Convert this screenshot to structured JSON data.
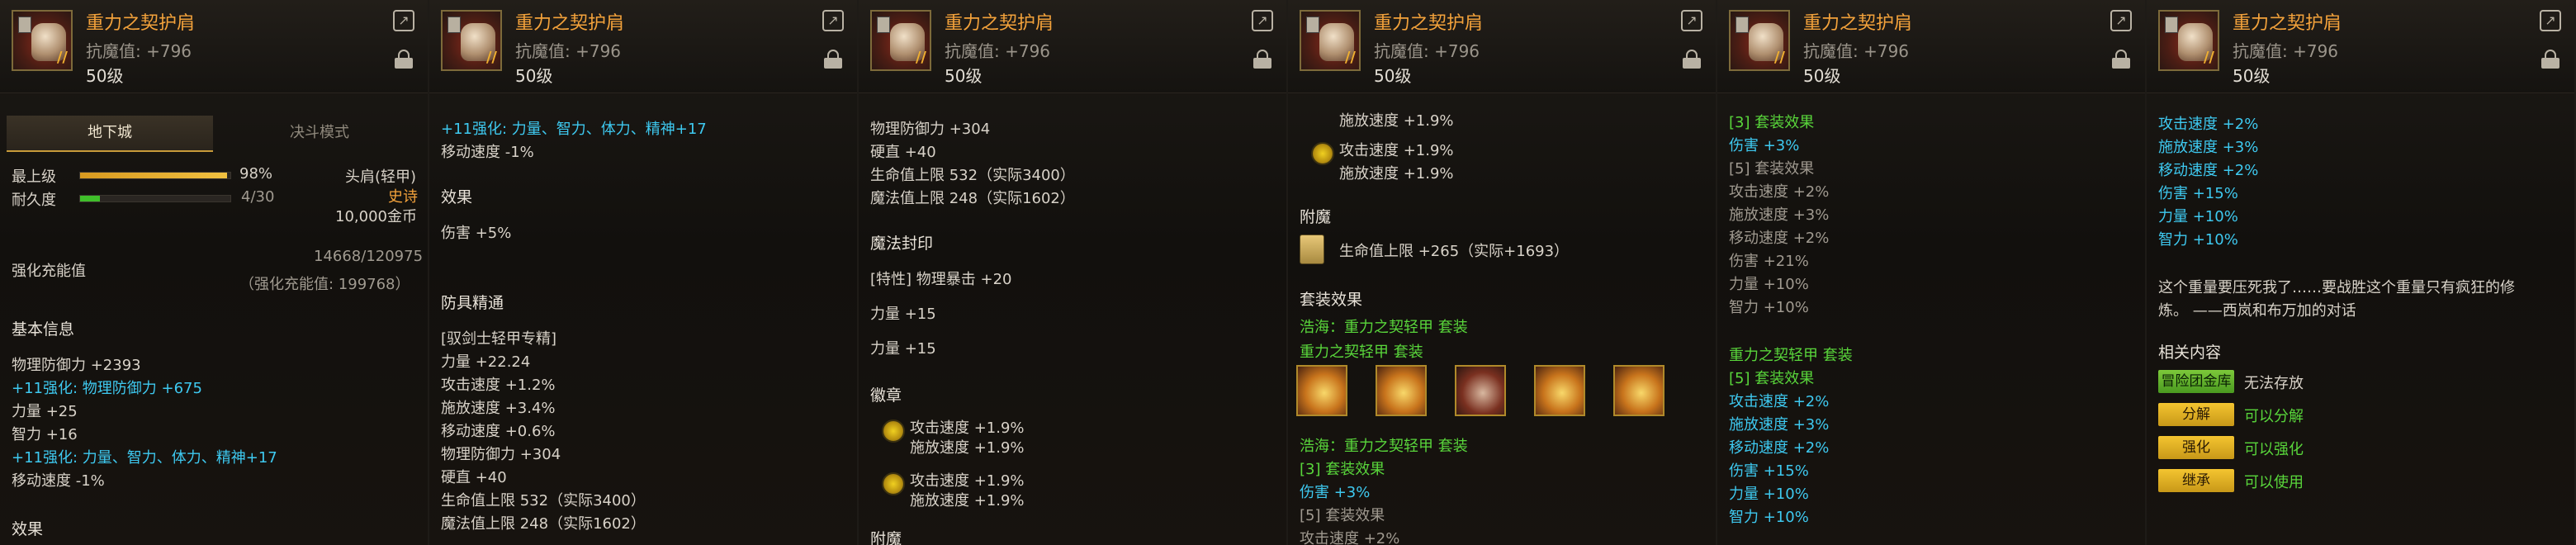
{
  "item": {
    "name": "重力之契护肩",
    "magic_resist": "抗魔值: +796",
    "level": "50级",
    "icon_mark": "//"
  },
  "p1": {
    "tab_dungeon": "地下城",
    "tab_duel": "决斗模式",
    "level_label": "最上级",
    "level_value": "98%",
    "level_fill": 0.98,
    "dur_label": "耐久度",
    "dur_value": "4/30",
    "dur_fill": 0.13,
    "slot": "头肩(轻甲)",
    "rarity": "史诗",
    "price": "10,000金币",
    "amp_label": "强化充能值",
    "amp_value": "14668/120975",
    "amp_note": "（强化充能值: 199768）",
    "basic_title": "基本信息",
    "l1": "物理防御力 +2393",
    "l2": "+11强化: 物理防御力 +675",
    "l3": "力量 +25",
    "l4": "智力 +16",
    "l5": "+11强化: 力量、智力、体力、精神+17",
    "l6": "移动速度 -1%",
    "effect_title": "效果"
  },
  "p2": {
    "top_cut": "智力 +16",
    "l1": "+11强化: 力量、智力、体力、精神+17",
    "l2": "移动速度 -1%",
    "eff_title": "效果",
    "eff1": "伤害 +5%",
    "ar_title": "防具精通",
    "ar_sub": "[驭剑士轻甲专精]",
    "a1": "力量 +22.24",
    "a2": "攻击速度 +1.2%",
    "a3": "施放速度 +3.4%",
    "a4": "移动速度 +0.6%",
    "a5": "物理防御力 +304",
    "a6": "硬直 +40",
    "a7": "生命值上限 532（实际3400）",
    "a8": "魔法值上限 248（实际1602）"
  },
  "p3": {
    "top_cut": "移动速度 +0.6%",
    "l1": "物理防御力 +304",
    "l2": "硬直 +40",
    "l3": "生命值上限 532（实际3400）",
    "l4": "魔法值上限 248（实际1602）",
    "seal_title": "魔法封印",
    "seal1": "[特性] 物理暴击 +20",
    "seal2": "力量 +15",
    "seal3": "力量 +15",
    "emb_title": "徽章",
    "e1a": "攻击速度 +1.9%",
    "e1b": "施放速度 +1.9%",
    "e2a": "攻击速度 +1.9%",
    "e2b": "施放速度 +1.9%",
    "ench_title": "附魔"
  },
  "p4": {
    "top_a": "施放速度 +1.9%",
    "e2a": "攻击速度 +1.9%",
    "e2b": "施放速度 +1.9%",
    "ench_title": "附魔",
    "ench1": "生命值上限 +265（实际+1693）",
    "set_title": "套装效果",
    "set1": "浩海：重力之契轻甲 套装",
    "set2": "重力之契轻甲 套装",
    "set3": "浩海：重力之契轻甲 套装",
    "set4": "[3] 套装效果",
    "set5": "伤害 +3%",
    "set6": "[5] 套装效果",
    "set7": "攻击速度 +2%"
  },
  "p5": {
    "s1": "[3] 套装效果",
    "s2": "伤害 +3%",
    "s3": "[5] 套装效果",
    "s4": "攻击速度 +2%",
    "s5": "施放速度 +3%",
    "s6": "移动速度 +2%",
    "s7": "伤害 +21%",
    "s8": "力量 +10%",
    "s9": "智力 +10%",
    "t1": "重力之契轻甲 套装",
    "t2": "[5] 套装效果",
    "t3": "攻击速度 +2%",
    "t4": "施放速度 +3%",
    "t5": "移动速度 +2%",
    "t6": "伤害 +15%",
    "t7": "力量 +10%",
    "t8": "智力 +10%"
  },
  "p6": {
    "top_cut": "[5] 套装效果",
    "r1": "攻击速度 +2%",
    "r2": "施放速度 +3%",
    "r3": "移动速度 +2%",
    "r4": "伤害 +15%",
    "r5": "力量 +10%",
    "r6": "智力 +10%",
    "flavor1": "这个重量要压死我了……要战胜这个重量只有疯狂的修",
    "flavor2": "炼。 ——西岚和布万加的对话",
    "rel_title": "相关内容",
    "b1": "冒险团金库",
    "b1t": "无法存放",
    "b2": "分解",
    "b2t": "可以分解",
    "b3": "强化",
    "b3t": "可以强化",
    "b4": "继承",
    "b4t": "可以使用"
  }
}
